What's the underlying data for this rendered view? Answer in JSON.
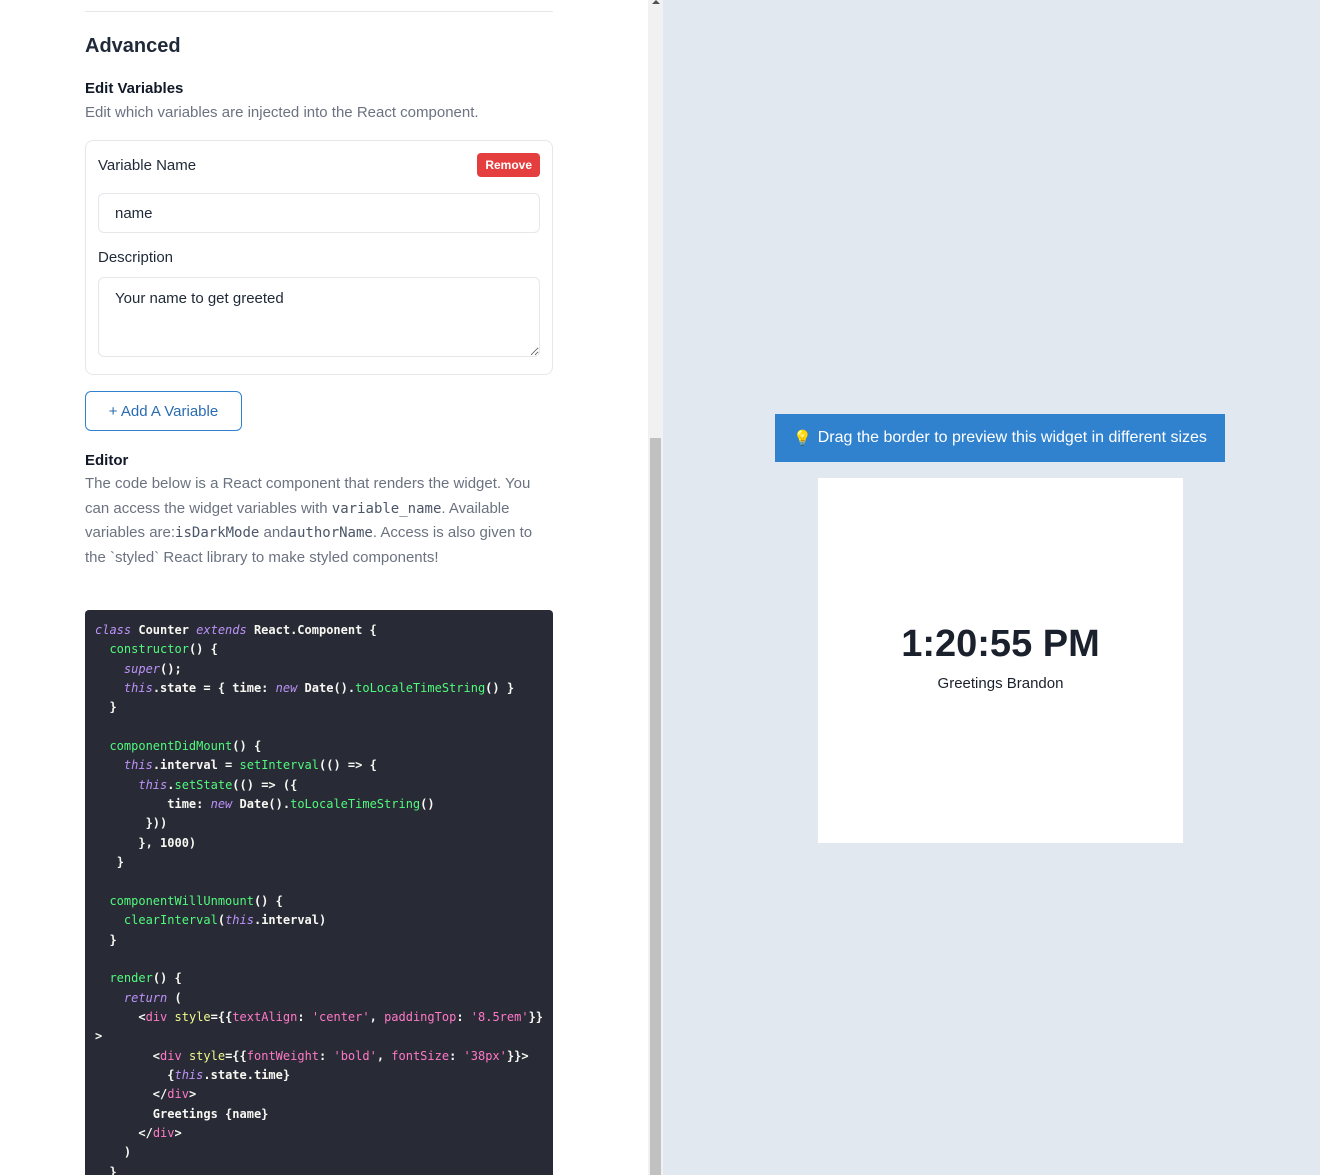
{
  "advanced": {
    "title": "Advanced",
    "edit_variables": {
      "title": "Edit Variables",
      "description": "Edit which variables are injected into the React component.",
      "variables": [
        {
          "name_label": "Variable Name",
          "remove_label": "Remove",
          "name_value": "name",
          "description_label": "Description",
          "description_value": "Your name to get greeted"
        }
      ],
      "add_label": "+ Add A Variable"
    },
    "editor": {
      "title": "Editor",
      "desc_part1": "The code below is a React component that renders the widget. You can access the widget variables with ",
      "desc_code1": "variable_name",
      "desc_part2": ". Available variables are:",
      "desc_code2": "isDarkMode",
      "desc_part3": " and",
      "desc_code3": "authorName",
      "desc_part4": ". Access is also given to the `styled` React library to make styled components!"
    }
  },
  "preview": {
    "hint": "Drag the border to preview this widget in different sizes",
    "hint_icon": "lightbulb-icon",
    "time": "1:20:55 PM",
    "greeting": "Greetings Brandon"
  },
  "colors": {
    "accent": "#3182ce",
    "remove": "#e53e3e",
    "code_bg": "#282a36",
    "preview_bg": "#e2e8f0"
  }
}
